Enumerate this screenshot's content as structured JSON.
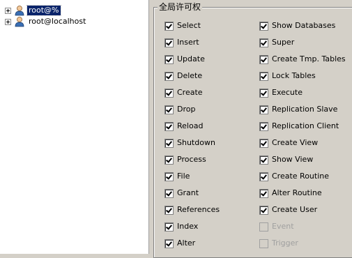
{
  "tree": {
    "nodes": [
      {
        "label": "root@%",
        "selected": true
      },
      {
        "label": "root@localhost",
        "selected": false
      }
    ]
  },
  "privileges": {
    "title": "全局许可权",
    "left": [
      {
        "label": "Select",
        "checked": true,
        "enabled": true
      },
      {
        "label": "Insert",
        "checked": true,
        "enabled": true
      },
      {
        "label": "Update",
        "checked": true,
        "enabled": true
      },
      {
        "label": "Delete",
        "checked": true,
        "enabled": true
      },
      {
        "label": "Create",
        "checked": true,
        "enabled": true
      },
      {
        "label": "Drop",
        "checked": true,
        "enabled": true
      },
      {
        "label": "Reload",
        "checked": true,
        "enabled": true
      },
      {
        "label": "Shutdown",
        "checked": true,
        "enabled": true
      },
      {
        "label": "Process",
        "checked": true,
        "enabled": true
      },
      {
        "label": "File",
        "checked": true,
        "enabled": true
      },
      {
        "label": "Grant",
        "checked": true,
        "enabled": true
      },
      {
        "label": "References",
        "checked": true,
        "enabled": true
      },
      {
        "label": "Index",
        "checked": true,
        "enabled": true
      },
      {
        "label": "Alter",
        "checked": true,
        "enabled": true
      }
    ],
    "right": [
      {
        "label": "Show Databases",
        "checked": true,
        "enabled": true
      },
      {
        "label": "Super",
        "checked": true,
        "enabled": true
      },
      {
        "label": "Create Tmp. Tables",
        "checked": true,
        "enabled": true
      },
      {
        "label": "Lock Tables",
        "checked": true,
        "enabled": true
      },
      {
        "label": "Execute",
        "checked": true,
        "enabled": true
      },
      {
        "label": "Replication Slave",
        "checked": true,
        "enabled": true
      },
      {
        "label": "Replication Client",
        "checked": true,
        "enabled": true
      },
      {
        "label": "Create View",
        "checked": true,
        "enabled": true
      },
      {
        "label": "Show View",
        "checked": true,
        "enabled": true
      },
      {
        "label": "Create Routine",
        "checked": true,
        "enabled": true
      },
      {
        "label": "Alter Routine",
        "checked": true,
        "enabled": true
      },
      {
        "label": "Create User",
        "checked": true,
        "enabled": true
      },
      {
        "label": "Event",
        "checked": false,
        "enabled": false
      },
      {
        "label": "Trigger",
        "checked": false,
        "enabled": false
      }
    ]
  }
}
